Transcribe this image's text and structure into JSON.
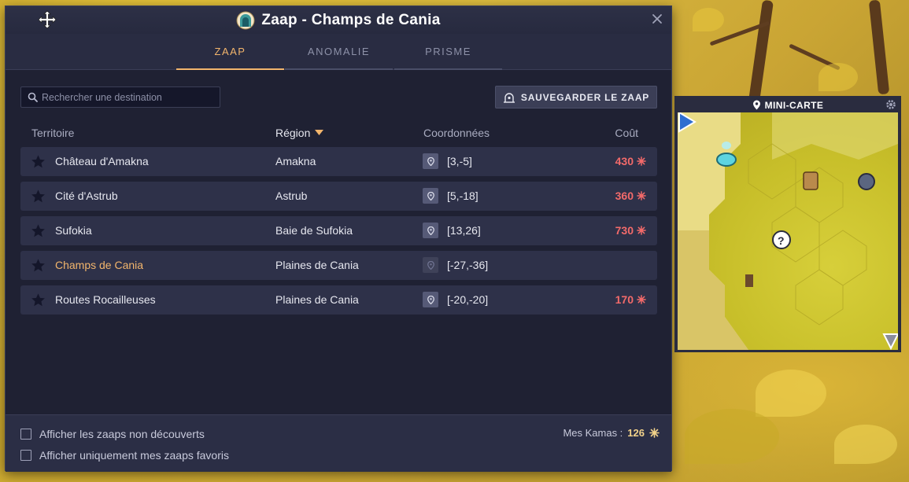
{
  "window": {
    "title": "Zaap - Champs de Cania",
    "tabs": [
      {
        "label": "ZAAP",
        "active": true
      },
      {
        "label": "ANOMALIE",
        "active": false
      },
      {
        "label": "PRISME",
        "active": false
      }
    ],
    "search": {
      "placeholder": "Rechercher une destination",
      "value": ""
    },
    "save_button": "SAUVEGARDER LE ZAAP",
    "columns": {
      "territory": "Territoire",
      "region": "Région",
      "coords": "Coordonnées",
      "cost": "Coût"
    },
    "rows": [
      {
        "territory": "Château d'Amakna",
        "region": "Amakna",
        "coords": "[3,-5]",
        "cost": "430",
        "current": false
      },
      {
        "territory": "Cité d'Astrub",
        "region": "Astrub",
        "coords": "[5,-18]",
        "cost": "360",
        "current": false
      },
      {
        "territory": "Sufokia",
        "region": "Baie de Sufokia",
        "coords": "[13,26]",
        "cost": "730",
        "current": false
      },
      {
        "territory": "Champs de Cania",
        "region": "Plaines de Cania",
        "coords": "[-27,-36]",
        "cost": "",
        "current": true
      },
      {
        "territory": "Routes Rocailleuses",
        "region": "Plaines de Cania",
        "coords": "[-20,-20]",
        "cost": "170",
        "current": false
      }
    ],
    "footer": {
      "show_undiscovered": "Afficher les zaaps non découverts",
      "show_favorites": "Afficher uniquement mes zaaps favoris",
      "kamas_label": "Mes Kamas :",
      "kamas_value": "126"
    }
  },
  "minimap": {
    "title": "MINI-CARTE"
  },
  "colors": {
    "accent": "#f2b56c",
    "cost": "#f26a6a",
    "panel": "#1f2133",
    "row": "#2e3149"
  },
  "icons": [
    "move-icon",
    "zaap-icon",
    "close-icon",
    "search-icon",
    "zaap-save-icon",
    "sort-arrow-icon",
    "star-icon",
    "map-pin-icon",
    "kamas-icon",
    "gear-icon"
  ]
}
